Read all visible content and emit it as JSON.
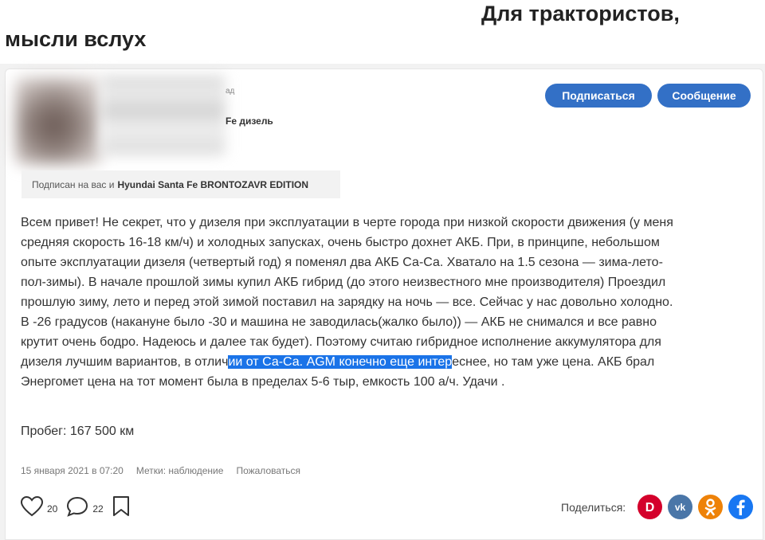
{
  "header": {
    "title_line1": "Для трактористов,",
    "title_line2": "мысли вслух"
  },
  "author": {
    "meta_line1": "ад",
    "meta_line2": "Fe дизель",
    "subscribe_label": "Подписаться",
    "message_label": "Сообщение"
  },
  "follow_note": {
    "prefix": "Подписан на вас и",
    "car": "Hyundai Santa Fe BRONTOZAVR EDITION"
  },
  "post": {
    "text_before": "Всем привет! Не секрет, что у дизеля при эксплуатации в черте города при низкой скорости движения (у меня средняя скорость 16-18 км/ч) и холодных запусках, очень быстро дохнет АКБ. При, в принципе, небольшом опыте эксплуатации дизеля (четвертый год) я поменял два АКБ Са-Са. Хватало на 1.5 сезона — зима-лето-пол-зимы). В начале прошлой зимы купил АКБ гибрид (до этого неизвестного мне производителя) Проездил прошлую зиму, лето и перед этой зимой поставил на зарядку на ночь — все. Сейчас у нас довольно холодно. В -26 градусов (накануне было -30 и машина не заводилась(жалко было)) — АКБ не снимался и все равно крутит очень бодро. Надеюсь и далее так будет). Поэтому считаю гибридное исполнение аккумулятора для дизеля лучшим вариантов, в отлич",
    "text_highlighted": "ии от Са-Са. AGM конечно еще интер",
    "text_after": "еснее, но там уже цена. АКБ брал Энергомет цена на тот момент была в пределах 5-6 тыр, емкость 100 а/ч. Удачи .",
    "mileage": "Пробег: 167 500 км",
    "date": "15 января 2021 в 07:20",
    "tags_label": "Метки: наблюдение",
    "report_label": "Пожаловаться"
  },
  "actions": {
    "likes": "20",
    "comments": "22"
  },
  "share": {
    "label": "Поделиться:",
    "networks": [
      "drive-icon",
      "vk-icon",
      "odnoklassniki-icon",
      "facebook-icon"
    ]
  },
  "colors": {
    "primary": "#3370c6",
    "highlight": "#1a73e8",
    "drive": "#d4002b",
    "vk": "#4a76a8",
    "ok": "#ee8208",
    "facebook": "#1877f2"
  }
}
